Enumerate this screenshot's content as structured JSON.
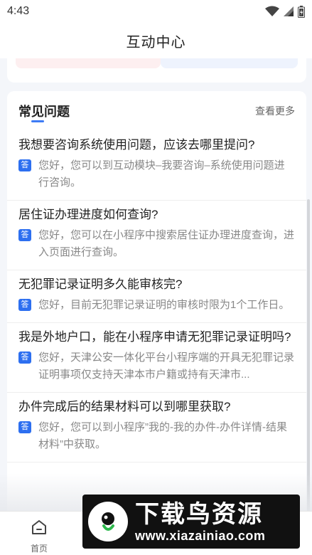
{
  "status_bar": {
    "time": "4:43",
    "icons": [
      "wifi-icon",
      "signal-icon",
      "battery-icon"
    ]
  },
  "header": {
    "title": "互动中心"
  },
  "faq": {
    "title": "常见问题",
    "more_label": "查看更多",
    "badge_label": "答",
    "items": [
      {
        "question": "我想要咨询系统使用问题，应该去哪里提问?",
        "answer": "您好，您可以到互动模块–我要咨询–系统使用问题进行咨询。"
      },
      {
        "question": "居住证办理进度如何查询?",
        "answer": "您好，您可以在小程序中搜索居住证办理进度查询，进入页面进行查询。"
      },
      {
        "question": "无犯罪记录证明多久能审核完?",
        "answer": "您好，目前无犯罪记录证明的审核时限为1个工作日。"
      },
      {
        "question": "我是外地户口，能在小程序申请无犯罪记录证明吗?",
        "answer": "您好，天津公安一体化平台小程序端的开具无犯罪记录证明事项仅支持天津本市户籍或持有天津市..."
      },
      {
        "question": "办件完成后的结果材料可以到哪里获取?",
        "answer": "您好，您可以到小程序”我的-我的办件-办件详情-结果材料”中获取。"
      }
    ]
  },
  "bottom_nav": {
    "items": [
      {
        "label": "首页",
        "icon": "home-icon"
      }
    ]
  },
  "watermark": {
    "brand": "下载鸟资源",
    "url": "www.xiazainiao.com"
  },
  "colors": {
    "accent": "#2d6ff0",
    "background": "#f4f6fa",
    "card": "#ffffff",
    "muted_text": "#888888"
  }
}
